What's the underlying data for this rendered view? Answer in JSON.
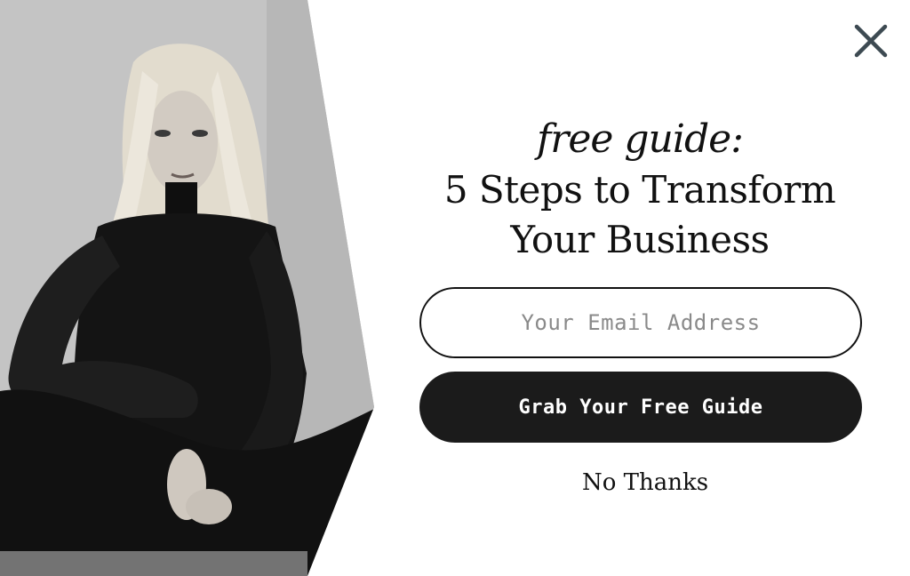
{
  "modal": {
    "eyebrow": "free guide:",
    "title_line1": "5 Steps to Transform",
    "title_line2": "Your Business",
    "email_placeholder": "Your Email Address",
    "cta_label": "Grab Your Free Guide",
    "dismiss_label": "No Thanks",
    "close_icon": "close-icon"
  },
  "colors": {
    "accent": "#1b1b1b",
    "background": "#ffffff",
    "text": "#111111",
    "placeholder": "#8a8a8a",
    "close_icon": "#3d4a52"
  }
}
